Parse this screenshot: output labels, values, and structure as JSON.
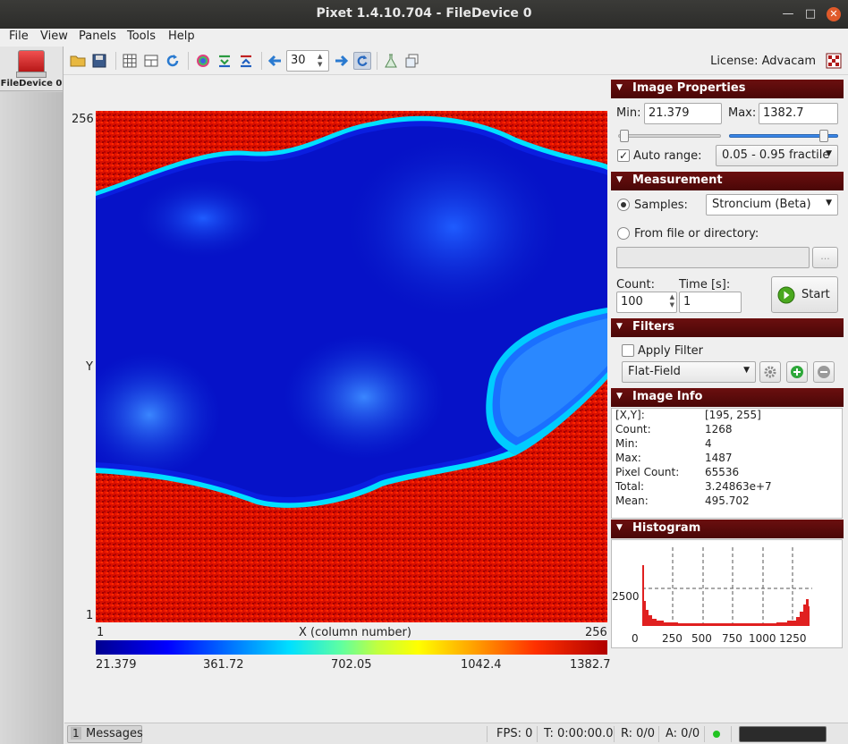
{
  "window": {
    "title": "Pixet 1.4.10.704 - FileDevice 0"
  },
  "menu": [
    "File",
    "View",
    "Panels",
    "Tools",
    "Help"
  ],
  "sidebar": {
    "device_label": "FileDevice 0"
  },
  "toolbar": {
    "frame_count": "30",
    "license": "License: Advacam"
  },
  "plot": {
    "y_max_label": "256",
    "y_min_label": "1",
    "y_label": "Y",
    "x_min_label": "1",
    "x_max_label": "256",
    "x_label": "X (column number)",
    "colorbar_ticks": [
      "21.379",
      "361.72",
      "702.05",
      "1042.4",
      "1382.7"
    ]
  },
  "image_properties": {
    "title": "Image Properties",
    "min_label": "Min:",
    "min_value": "21.379",
    "max_label": "Max:",
    "max_value": "1382.7",
    "auto_range_label": "Auto range:",
    "auto_range_checked": true,
    "range_mode": "0.05 - 0.95 fractile",
    "min_slider_fraction": 0.02,
    "max_slider_fraction": 0.95
  },
  "measurement": {
    "title": "Measurement",
    "samples_label": "Samples:",
    "sample": "Stroncium (Beta)",
    "from_file_label": "From file or directory:",
    "path": "",
    "browse_label": "...",
    "count_label": "Count:",
    "count": "100",
    "time_label": "Time [s]:",
    "time": "1",
    "start_label": "Start"
  },
  "filters": {
    "title": "Filters",
    "apply_label": "Apply Filter",
    "filter": "Flat-Field"
  },
  "image_info": {
    "title": "Image Info",
    "rows": [
      {
        "k": "[X,Y]:",
        "v": "[195, 255]"
      },
      {
        "k": "Count:",
        "v": "1268"
      },
      {
        "k": "Min:",
        "v": "4"
      },
      {
        "k": "Max:",
        "v": "1487"
      },
      {
        "k": "Pixel Count:",
        "v": "65536"
      },
      {
        "k": "Total:",
        "v": "3.24863e+7"
      },
      {
        "k": "Mean:",
        "v": "495.702"
      }
    ]
  },
  "histogram": {
    "title": "Histogram",
    "y_ticks": [
      "2500",
      "0"
    ],
    "x_ticks": [
      "250",
      "500",
      "750",
      "1000",
      "1250"
    ]
  },
  "status": {
    "messages_count": "1",
    "messages_label": "Messages",
    "fps": "FPS: 0",
    "time": "T: 0:00:00.0",
    "r": "R: 0/0",
    "a": "A: 0/0",
    "status_color": "#22c422"
  }
}
